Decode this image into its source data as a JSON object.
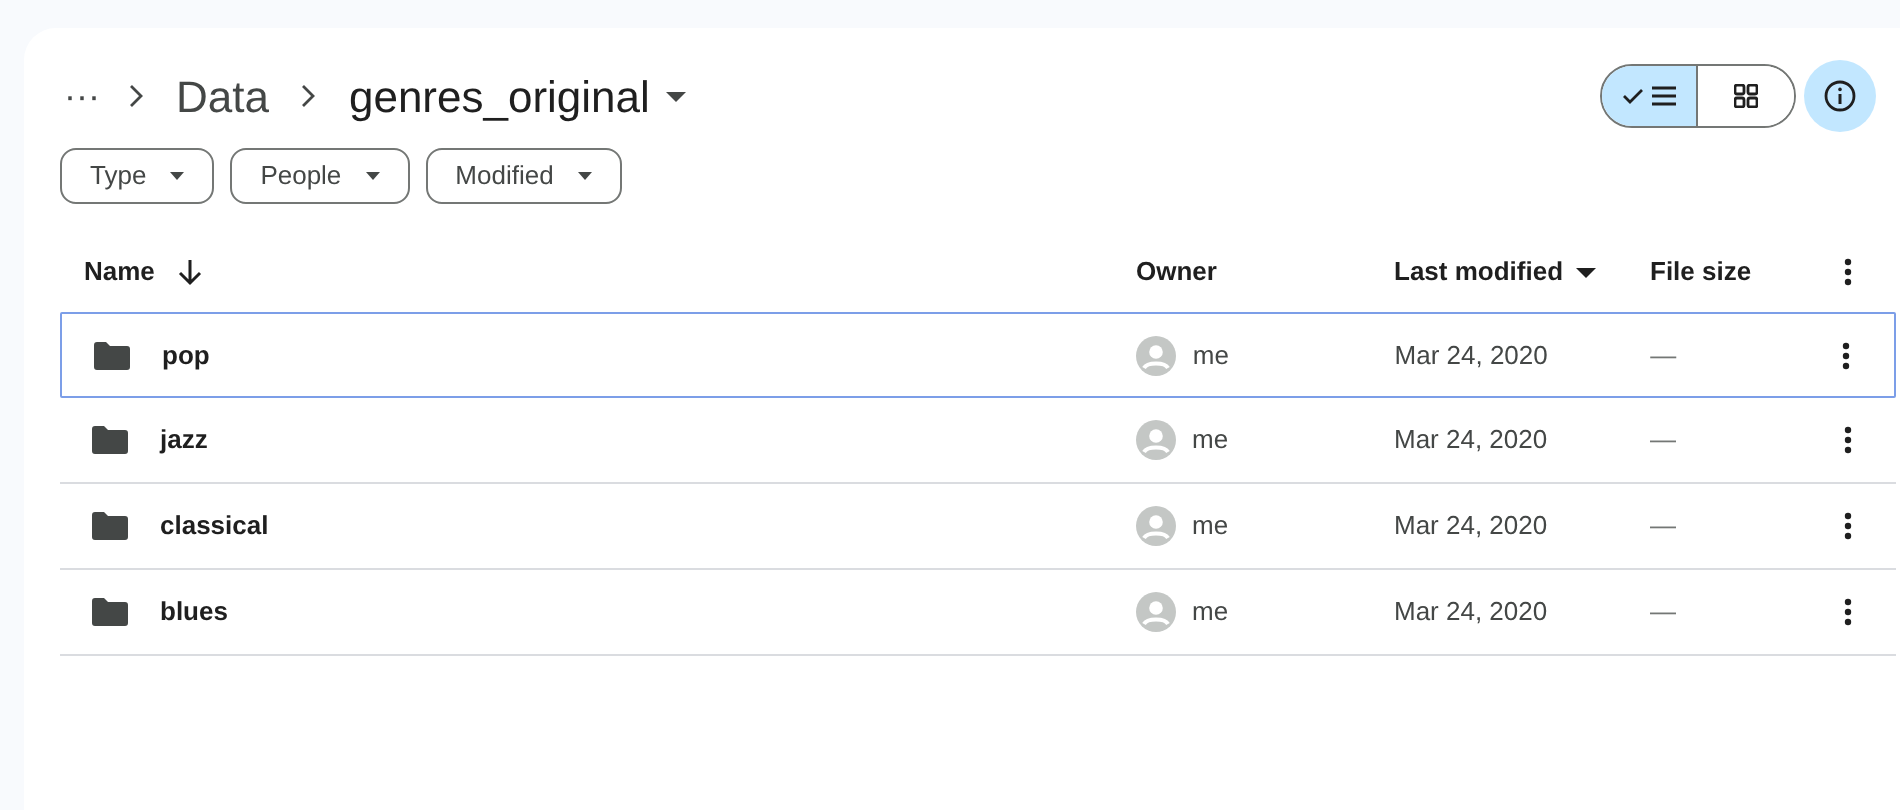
{
  "breadcrumb": {
    "overflow": "···",
    "items": [
      {
        "label": "Data",
        "current": false
      },
      {
        "label": "genres_original",
        "current": true
      }
    ]
  },
  "view_toggle": [
    {
      "kind": "list",
      "selected": true
    },
    {
      "kind": "grid",
      "selected": false
    }
  ],
  "details_button": {
    "selected": true
  },
  "filters": [
    {
      "label": "Type"
    },
    {
      "label": "People"
    },
    {
      "label": "Modified"
    }
  ],
  "table": {
    "columns": [
      {
        "label": "Name",
        "kind": "arrow"
      },
      {
        "label": "Owner",
        "kind": "plain"
      },
      {
        "label": "Last modified",
        "kind": "caret"
      },
      {
        "label": "File size",
        "kind": "plain"
      }
    ],
    "rows": [
      {
        "name": "pop",
        "owner": "me",
        "modified": "Mar 24, 2020",
        "size": "—",
        "selected": true
      },
      {
        "name": "jazz",
        "owner": "me",
        "modified": "Mar 24, 2020",
        "size": "—",
        "selected": false
      },
      {
        "name": "classical",
        "owner": "me",
        "modified": "Mar 24, 2020",
        "size": "—",
        "selected": false
      },
      {
        "name": "blues",
        "owner": "me",
        "modified": "Mar 24, 2020",
        "size": "—",
        "selected": false
      }
    ]
  }
}
